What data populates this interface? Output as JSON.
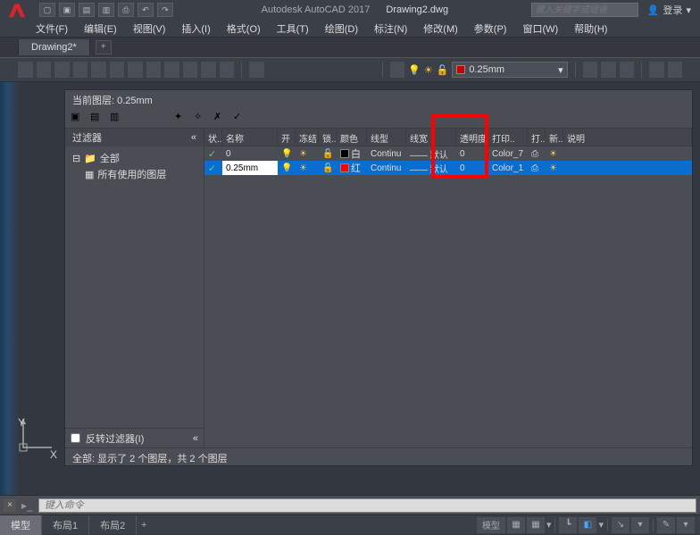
{
  "title": {
    "app": "Autodesk AutoCAD 2017",
    "file": "Drawing2.dwg"
  },
  "search_placeholder": "键入关键字或短语",
  "login_label": "登录",
  "menu": [
    "文件(F)",
    "编辑(E)",
    "视图(V)",
    "插入(I)",
    "格式(O)",
    "工具(T)",
    "绘图(D)",
    "标注(N)",
    "修改(M)",
    "参数(P)",
    "窗口(W)",
    "帮助(H)"
  ],
  "file_tab": "Drawing2*",
  "layer_combo": "0.25mm",
  "layer_panel": {
    "title": "当前图层: 0.25mm",
    "filter_head": "过滤器",
    "filter_tree": {
      "all": "全部",
      "used": "所有使用的图层"
    },
    "columns": [
      "状..",
      "名称",
      "开",
      "冻结",
      "锁..",
      "颜色",
      "线型",
      "线宽",
      "透明度",
      "打印..",
      "打..",
      "新..",
      "说明"
    ],
    "rows": [
      {
        "status": "✓",
        "name": "0",
        "on": "💡",
        "freeze": "☀",
        "lock": "🔓",
        "color": "白",
        "color_hex": "#ffffff",
        "ltype": "Continu",
        "lweight": "—— 默认",
        "trans": "0",
        "pstyle": "Color_7",
        "plot": "⎙",
        "new": "☀"
      },
      {
        "status": "✓",
        "name": "0.25mm",
        "on": "💡",
        "freeze": "☀",
        "lock": "🔓",
        "color": "红",
        "color_hex": "#ff0000",
        "ltype": "Continu",
        "lweight": "—— 默认",
        "trans": "0",
        "pstyle": "Color_1",
        "plot": "⎙",
        "new": "☀"
      }
    ],
    "invert_label": "反转过滤器(I)",
    "status": "全部: 显示了 2 个图层，共 2 个图层"
  },
  "cmd_placeholder": "键入命令",
  "tabs": {
    "model": "模型",
    "layout1": "布局1",
    "layout2": "布局2"
  },
  "sb_model": "模型",
  "ucs": {
    "x": "X",
    "y": "Y"
  }
}
